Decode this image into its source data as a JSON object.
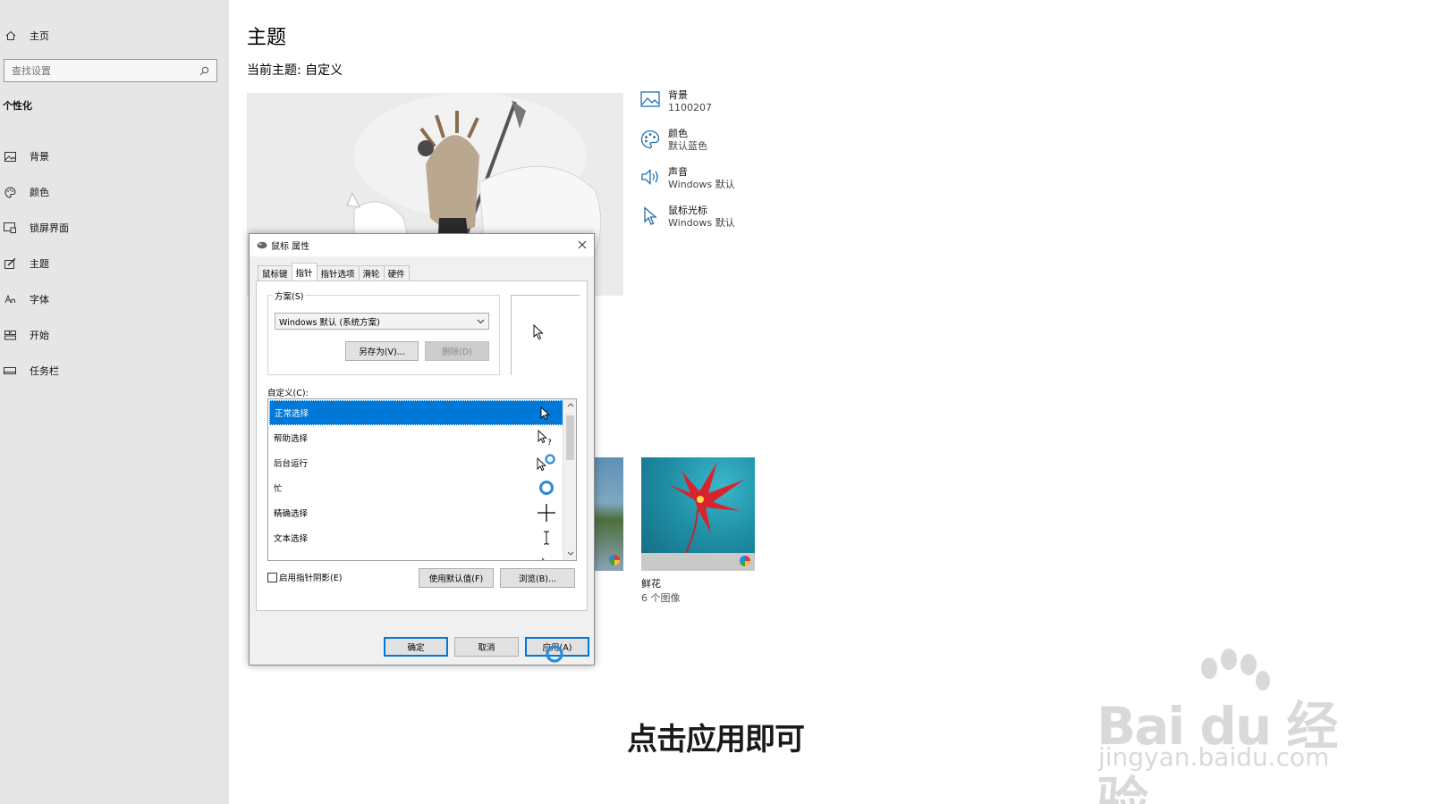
{
  "sidebar": {
    "home_label": "主页",
    "search_placeholder": "查找设置",
    "section_title": "个性化",
    "items": [
      {
        "label": "背景",
        "icon": "image-icon"
      },
      {
        "label": "颜色",
        "icon": "palette-icon"
      },
      {
        "label": "锁屏界面",
        "icon": "lock-screen-icon"
      },
      {
        "label": "主题",
        "icon": "theme-icon"
      },
      {
        "label": "字体",
        "icon": "font-icon"
      },
      {
        "label": "开始",
        "icon": "start-icon"
      },
      {
        "label": "任务栏",
        "icon": "taskbar-icon"
      }
    ]
  },
  "main": {
    "title": "主题",
    "current_theme": "当前主题: 自定义",
    "props": [
      {
        "label": "背景",
        "value": "1100207",
        "icon": "image-icon"
      },
      {
        "label": "颜色",
        "value": "默认蓝色",
        "icon": "palette-icon"
      },
      {
        "label": "声音",
        "value": "Windows 默认",
        "icon": "speaker-icon"
      },
      {
        "label": "鼠标光标",
        "value": "Windows 默认",
        "icon": "cursor-icon"
      }
    ],
    "theme_card": {
      "name": "鲜花",
      "count": "6 个图像"
    }
  },
  "dialog": {
    "title": "鼠标 属性",
    "tabs": [
      "鼠标键",
      "指针",
      "指针选项",
      "滑轮",
      "硬件"
    ],
    "active_tab": 1,
    "scheme_legend": "方案(S)",
    "scheme_value": "Windows 默认 (系统方案)",
    "save_as": "另存为(V)...",
    "delete": "删除(D)",
    "custom_label": "自定义(C):",
    "cursor_rows": [
      {
        "label": "正常选择",
        "icon": "arrow-cursor-icon"
      },
      {
        "label": "帮助选择",
        "icon": "help-cursor-icon"
      },
      {
        "label": "后台运行",
        "icon": "working-cursor-icon"
      },
      {
        "label": "忙",
        "icon": "busy-cursor-icon"
      },
      {
        "label": "精确选择",
        "icon": "crosshair-cursor-icon"
      },
      {
        "label": "文本选择",
        "icon": "text-cursor-icon"
      }
    ],
    "shadow_label": "启用指针阴影(E)",
    "use_default": "使用默认值(F)",
    "browse": "浏览(B)...",
    "ok": "确定",
    "cancel": "取消",
    "apply": "应用(A)"
  },
  "overlay": {
    "subtitle": "点击应用即可",
    "watermark_brand": "Bai du 经验",
    "watermark_url": "jingyan.baidu.com"
  },
  "colors": {
    "accent": "#0078d7",
    "sidebar_bg": "#e6e6e6",
    "dialog_bg": "#f0f0f0"
  }
}
